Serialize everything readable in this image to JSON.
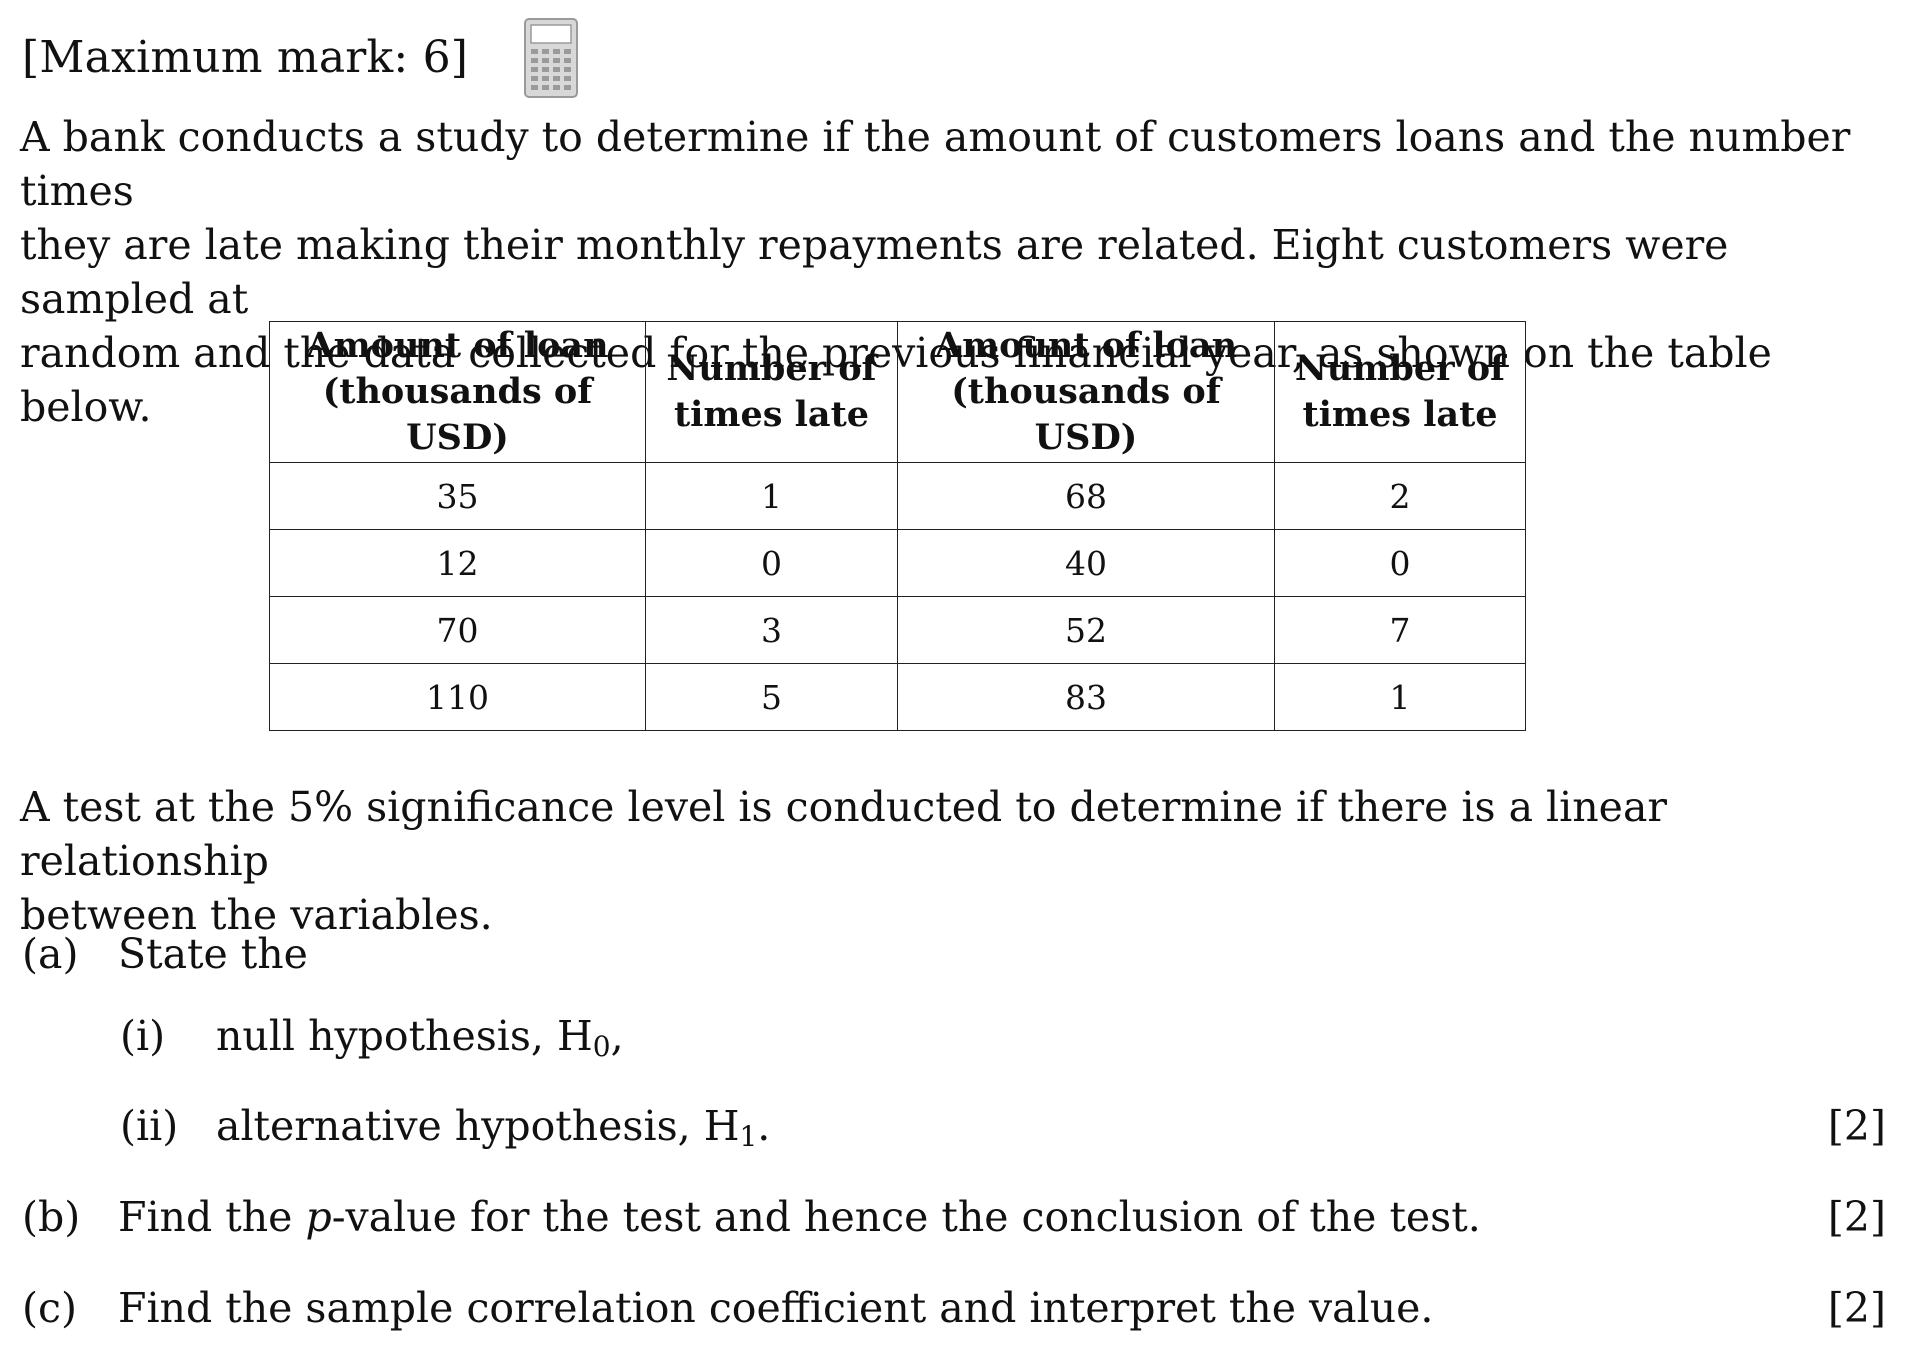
{
  "header": {
    "max_mark": "[Maximum mark: 6]",
    "calculator_icon": "calculator-icon"
  },
  "intro": {
    "line1": "A bank conducts a study to determine if the amount of customers loans and the number times",
    "line2": "they are late making their monthly repayments are related. Eight customers were sampled at",
    "line3": "random and the data collected for the previous financial year, as shown on the table below."
  },
  "table": {
    "headers": [
      [
        "Amount of loan",
        "(thousands of",
        "USD)"
      ],
      [
        "Number of",
        "times late"
      ],
      [
        "Amount of loan",
        "(thousands of",
        "USD)"
      ],
      [
        "Number of",
        "times late"
      ]
    ],
    "rows": [
      [
        "35",
        "1",
        "68",
        "2"
      ],
      [
        "12",
        "0",
        "40",
        "0"
      ],
      [
        "70",
        "3",
        "52",
        "7"
      ],
      [
        "110",
        "5",
        "83",
        "1"
      ]
    ]
  },
  "test_paragraph": {
    "line1": "A test at the 5% significance level is conducted to determine if there is a linear relationship",
    "line2": "between the variables."
  },
  "questions": {
    "a": {
      "label": "(a)",
      "text": "State the",
      "i": {
        "label": "(i)",
        "text": "null hypothesis, H",
        "sub": "0",
        "end": ","
      },
      "ii": {
        "label": "(ii)",
        "text": "alternative hypothesis, H",
        "sub": "1",
        "end": ".",
        "marks": "[2]"
      }
    },
    "b": {
      "label": "(b)",
      "text_before": "Find the ",
      "italic": "p",
      "text_after": "-value for the test and hence the conclusion of the test.",
      "marks": "[2]"
    },
    "c": {
      "label": "(c)",
      "text": "Find the sample correlation coefficient and interpret the value.",
      "marks": "[2]"
    }
  }
}
